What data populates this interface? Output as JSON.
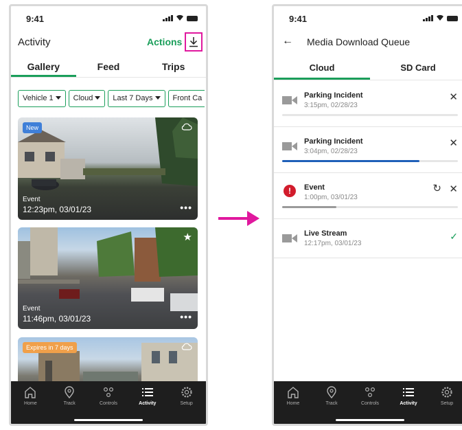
{
  "left": {
    "status_time": "9:41",
    "header_title": "Activity",
    "actions_label": "Actions",
    "tabs": [
      {
        "label": "Gallery",
        "active": true
      },
      {
        "label": "Feed"
      },
      {
        "label": "Trips"
      }
    ],
    "filters": [
      "Vehicle 1",
      "Cloud",
      "Last 7 Days",
      "Front Ca"
    ],
    "cards": [
      {
        "badge": "New",
        "label": "Event",
        "time": "12:23pm, 03/01/23",
        "icon": "cloud-icon"
      },
      {
        "label": "Event",
        "time": "11:46pm, 03/01/23",
        "icon": "star-icon"
      },
      {
        "badge": "Expires in 7 days",
        "icon": "cloud-icon"
      }
    ]
  },
  "right": {
    "status_time": "9:41",
    "header_title": "Media Download Queue",
    "tabs": [
      {
        "label": "Cloud",
        "active": true
      },
      {
        "label": "SD Card"
      }
    ],
    "queue": [
      {
        "title": "Parking Incident",
        "time": "3:15pm, 02/28/23",
        "progress": 0.0,
        "icon": "video-icon",
        "status": "queued"
      },
      {
        "title": "Parking Incident",
        "time": "3:04pm, 02/28/23",
        "progress": 0.78,
        "icon": "video-icon",
        "status": "downloading"
      },
      {
        "title": "Event",
        "time": "1:00pm, 03/01/23",
        "progress": 0.31,
        "icon": "error-icon",
        "status": "failed"
      },
      {
        "title": "Live Stream",
        "time": "12:17pm, 03/01/23",
        "icon": "video-icon",
        "status": "complete"
      }
    ]
  },
  "nav": [
    "Home",
    "Track",
    "Controls",
    "Activity",
    "Setup"
  ],
  "nav_active": "Activity",
  "colors": {
    "accent_green": "#1a9e5a",
    "highlight_magenta": "#e0189e",
    "progress_blue": "#1f5fb8",
    "error_red": "#d21c2c"
  }
}
